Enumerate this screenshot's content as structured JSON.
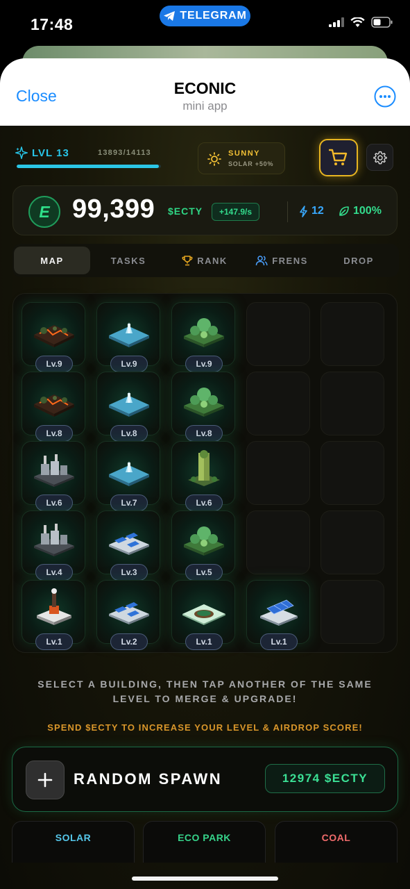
{
  "status_bar": {
    "time": "17:48",
    "pill_label": "TELEGRAM"
  },
  "header": {
    "close_label": "Close",
    "title": "ECONIC",
    "subtitle": "mini app"
  },
  "player": {
    "level_label": "LVL 13",
    "xp_text": "13893/14113",
    "xp_progress": 0.984
  },
  "weather": {
    "label": "SUNNY",
    "effect": "SOLAR +50%"
  },
  "balance": {
    "amount": "99,399",
    "unit": "$ECTY",
    "rate": "+147.9/s",
    "energy": "12",
    "eco": "100%",
    "badge_letter": "E"
  },
  "tabs": [
    {
      "label": "MAP",
      "icon": "",
      "active": true
    },
    {
      "label": "TASKS",
      "icon": "",
      "active": false
    },
    {
      "label": "RANK",
      "icon": "trophy-icon",
      "active": false
    },
    {
      "label": "FRENS",
      "icon": "people-icon",
      "active": false
    },
    {
      "label": "DROP",
      "icon": "",
      "active": false
    }
  ],
  "grid": {
    "rows": [
      [
        {
          "type": "coal",
          "level": "Lv.9"
        },
        {
          "type": "water",
          "level": "Lv.9"
        },
        {
          "type": "park",
          "level": "Lv.9"
        },
        null,
        null
      ],
      [
        {
          "type": "coal",
          "level": "Lv.8"
        },
        {
          "type": "water",
          "level": "Lv.8"
        },
        {
          "type": "park",
          "level": "Lv.8"
        },
        null,
        null
      ],
      [
        {
          "type": "factory",
          "level": "Lv.6"
        },
        {
          "type": "water",
          "level": "Lv.7"
        },
        {
          "type": "tower",
          "level": "Lv.6"
        },
        null,
        null
      ],
      [
        {
          "type": "factory",
          "level": "Lv.4"
        },
        {
          "type": "solar",
          "level": "Lv.3"
        },
        {
          "type": "park",
          "level": "Lv.5"
        },
        null,
        null
      ],
      [
        {
          "type": "chimney",
          "level": "Lv.1"
        },
        {
          "type": "solar",
          "level": "Lv.2"
        },
        {
          "type": "pond",
          "level": "Lv.1"
        },
        {
          "type": "panel",
          "level": "Lv.1"
        },
        null
      ]
    ]
  },
  "hints": {
    "merge": "SELECT A BUILDING, THEN TAP ANOTHER OF THE SAME LEVEL TO MERGE & UPGRADE!",
    "spend": "SPEND $ECTY TO INCREASE YOUR LEVEL & AIRDROP SCORE!"
  },
  "spawn": {
    "label": "RANDOM SPAWN",
    "cost": "12974 $ECTY"
  },
  "categories": [
    {
      "label": "SOLAR",
      "color": "#55c7ea"
    },
    {
      "label": "ECO PARK",
      "color": "#36d38a"
    },
    {
      "label": "COAL",
      "color": "#ef6b6b"
    }
  ],
  "colors": {
    "accent_cyan": "#28c5e8",
    "accent_green": "#33dc8d",
    "accent_gold": "#e7b521",
    "telegram_blue": "#1a78e6"
  }
}
